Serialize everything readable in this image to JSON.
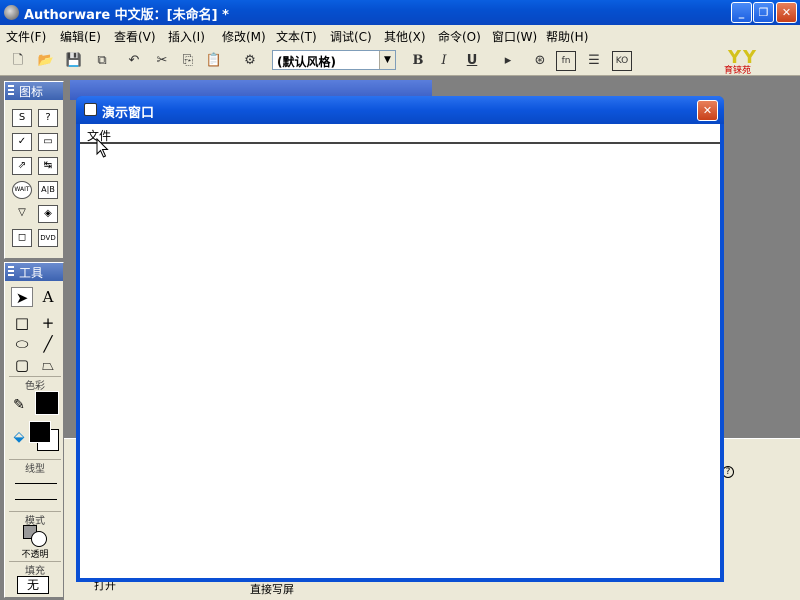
{
  "app": {
    "title": "Authorware 中文版：[未命名] *"
  },
  "menu": [
    "文件(F)",
    "编辑(E)",
    "查看(V)",
    "插入(I)",
    "修改(M)",
    "文本(T)",
    "调试(C)",
    "其他(X)",
    "命令(O)",
    "窗口(W)",
    "帮助(H)"
  ],
  "toolbar": {
    "style_value": "(默认风格)",
    "bold": "B",
    "italic": "I",
    "underline": "U"
  },
  "logo": {
    "letters": "YY",
    "text": "育铼苑"
  },
  "icons_panel": {
    "title": "图标",
    "buttons": [
      "S",
      "?",
      "✓",
      "▭",
      "⇗",
      "↹",
      "WAIT",
      "A|B",
      "▽",
      "◈",
      "◻",
      "DVD"
    ]
  },
  "tools_panel": {
    "title": "工具",
    "color_label": "色彩",
    "line_label": "线型",
    "mode_label": "模式",
    "mode_value": "不透明",
    "fill_label": "填充",
    "fill_value": "无"
  },
  "presentation": {
    "title": "演示窗口",
    "menu_item": "文件"
  },
  "background": {
    "button_text": "打开",
    "mode_text": "直接写屏"
  },
  "colors": {
    "title_blue": "#0a5fe0",
    "chrome": "#ece9d8",
    "close_red": "#c8401a"
  }
}
